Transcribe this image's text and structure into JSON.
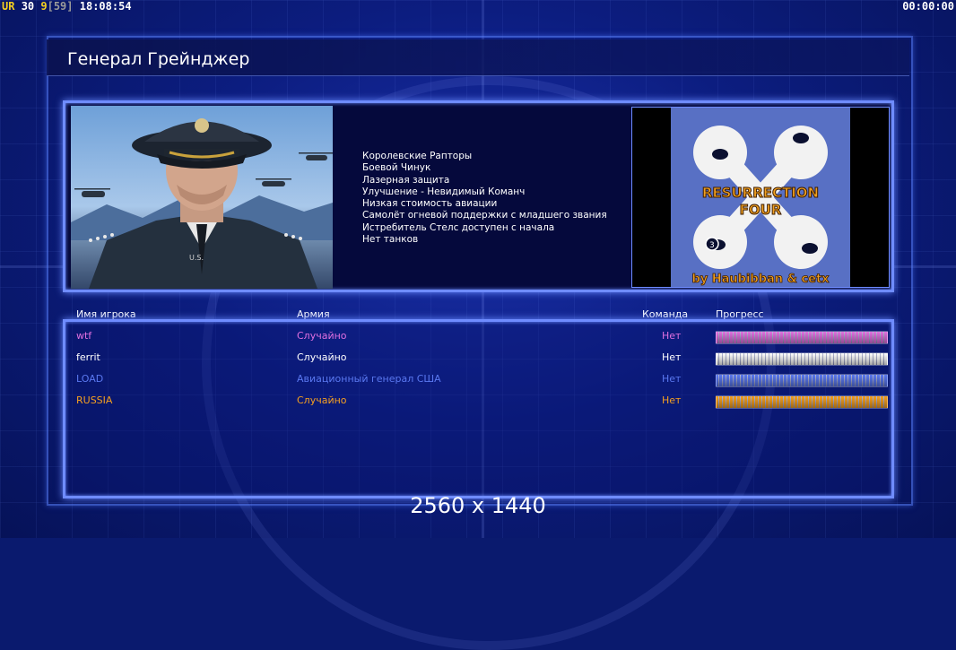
{
  "hud": {
    "left_tag": "UR",
    "left_num1": "30",
    "left_num2": "9",
    "left_bracket": "[59]",
    "clock": "18:08:54",
    "timer": "00:00:00"
  },
  "title": "Генерал Грейнджер",
  "general": {
    "perks": [
      "Королевские Рапторы",
      "Боевой Чинук",
      "Лазерная защита",
      "Улучшение - Невидимый Команч",
      "Низкая стоимость авиации",
      "Самолёт огневой поддержки с младшего звания",
      "Истребитель Стелс доступен с начала",
      "Нет танков"
    ]
  },
  "map": {
    "title_line1": "RESURRECTION",
    "title_line2": "FOUR",
    "credit": "by Haubibban & cetx",
    "badge": "3"
  },
  "columns": {
    "player": "Имя игрока",
    "army": "Армия",
    "team": "Команда",
    "progress": "Прогресс"
  },
  "players": [
    {
      "name": "wtf",
      "army": "Случайно",
      "team": "Нет",
      "color": "#e070e0",
      "progress": 1.0
    },
    {
      "name": "ferrit",
      "army": "Случайно",
      "team": "Нет",
      "color": "#ffffff",
      "progress": 1.0
    },
    {
      "name": "LOAD",
      "army": "Авиационный генерал США",
      "team": "Нет",
      "color": "#5a78f0",
      "progress": 1.0
    },
    {
      "name": "RUSSIA",
      "army": "Случайно",
      "team": "Нет",
      "color": "#f5a020",
      "progress": 1.0
    }
  ],
  "resolution": "2560 x 1440"
}
